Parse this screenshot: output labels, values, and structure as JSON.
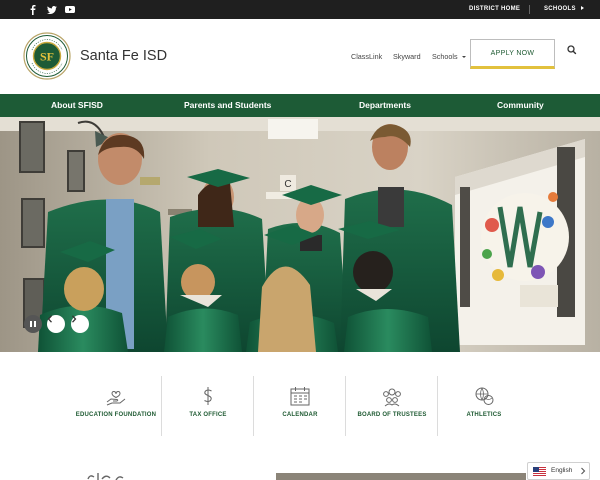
{
  "topbar": {
    "social": [
      {
        "name": "facebook-icon"
      },
      {
        "name": "twitter-icon"
      },
      {
        "name": "youtube-icon"
      }
    ],
    "district_home": "DISTRICT HOME",
    "schools": "SCHOOLS"
  },
  "header": {
    "logo_alt": "SF",
    "site_name": "Santa Fe ISD",
    "links": [
      "ClassLink",
      "Skyward",
      "Schools"
    ],
    "apply_now": "APPLY NOW"
  },
  "nav": [
    "About SFISD",
    "Parents and Students",
    "Departments",
    "Community"
  ],
  "hero": {
    "pause_icon": "pause-icon",
    "prev_icon": "chevron-left-icon",
    "next_icon": "chevron-right-icon"
  },
  "quicklinks": [
    {
      "label": "EDUCATION FOUNDATION",
      "icon": "hand-heart-icon"
    },
    {
      "label": "TAX OFFICE",
      "icon": "dollar-icon"
    },
    {
      "label": "CALENDAR",
      "icon": "calendar-icon"
    },
    {
      "label": "BOARD OF TRUSTEES",
      "icon": "people-group-icon"
    },
    {
      "label": "ATHLETICS",
      "icon": "balls-icon"
    }
  ],
  "language": {
    "label": "English"
  },
  "colors": {
    "brand_green": "#1d5b36",
    "accent_gold": "#e2c13d",
    "topbar": "#1f1f1f"
  }
}
